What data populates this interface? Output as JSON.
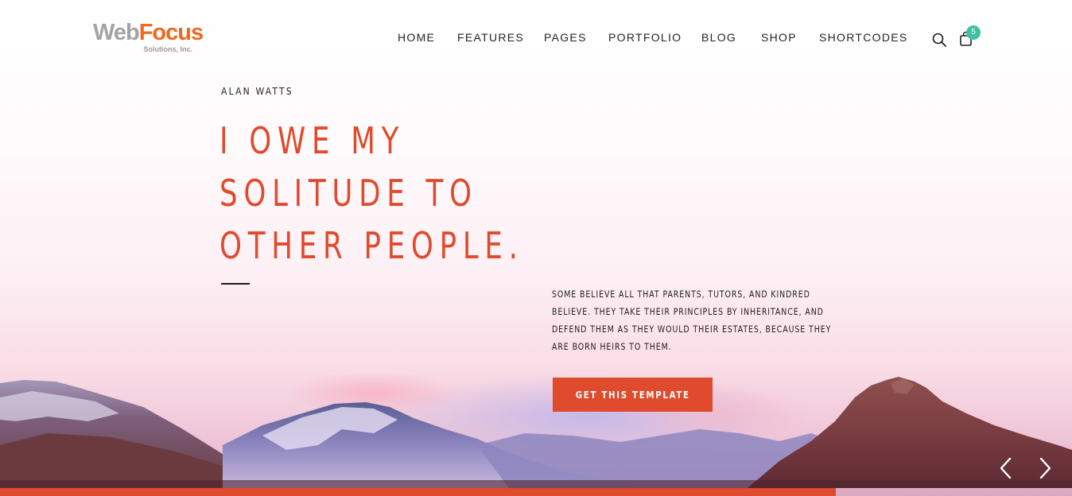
{
  "brand": {
    "logo_part1": "Web",
    "logo_part2": "Focus",
    "logo_sub": "Solutions, Inc."
  },
  "nav": {
    "items": [
      "HOME",
      "FEATURES",
      "PAGES",
      "PORTFOLIO",
      "BLOG",
      "SHOP",
      "SHORTCODES"
    ],
    "search_icon": "search-icon",
    "cart_icon": "shopping-bag-icon",
    "cart_count": "5"
  },
  "slide": {
    "author": "ALAN WATTS",
    "headline_lines": [
      "I OWE MY",
      "SOLITUDE TO",
      "OTHER PEOPLE."
    ],
    "paragraph_lines": [
      "SOME BELIEVE ALL THAT PARENTS, TUTORS, AND KINDRED",
      "BELIEVE. THEY TAKE THEIR PRINCIPLES BY INHERITANCE, AND",
      "DEFEND THEM AS THEY WOULD THEIR ESTATES, BECAUSE THEY",
      "ARE BORN HEIRS TO THEM."
    ],
    "cta_label": "GET THIS TEMPLATE",
    "progress": 0.78
  },
  "slider_controls": {
    "prev_icon": "chevron-left-icon",
    "next_icon": "chevron-right-icon"
  },
  "colors": {
    "accent": "#e04a2d",
    "badge": "#3fc1a1",
    "logo_grey": "#a3a3a3",
    "logo_orange": "#ee6a1f",
    "text_dark": "#222222"
  }
}
